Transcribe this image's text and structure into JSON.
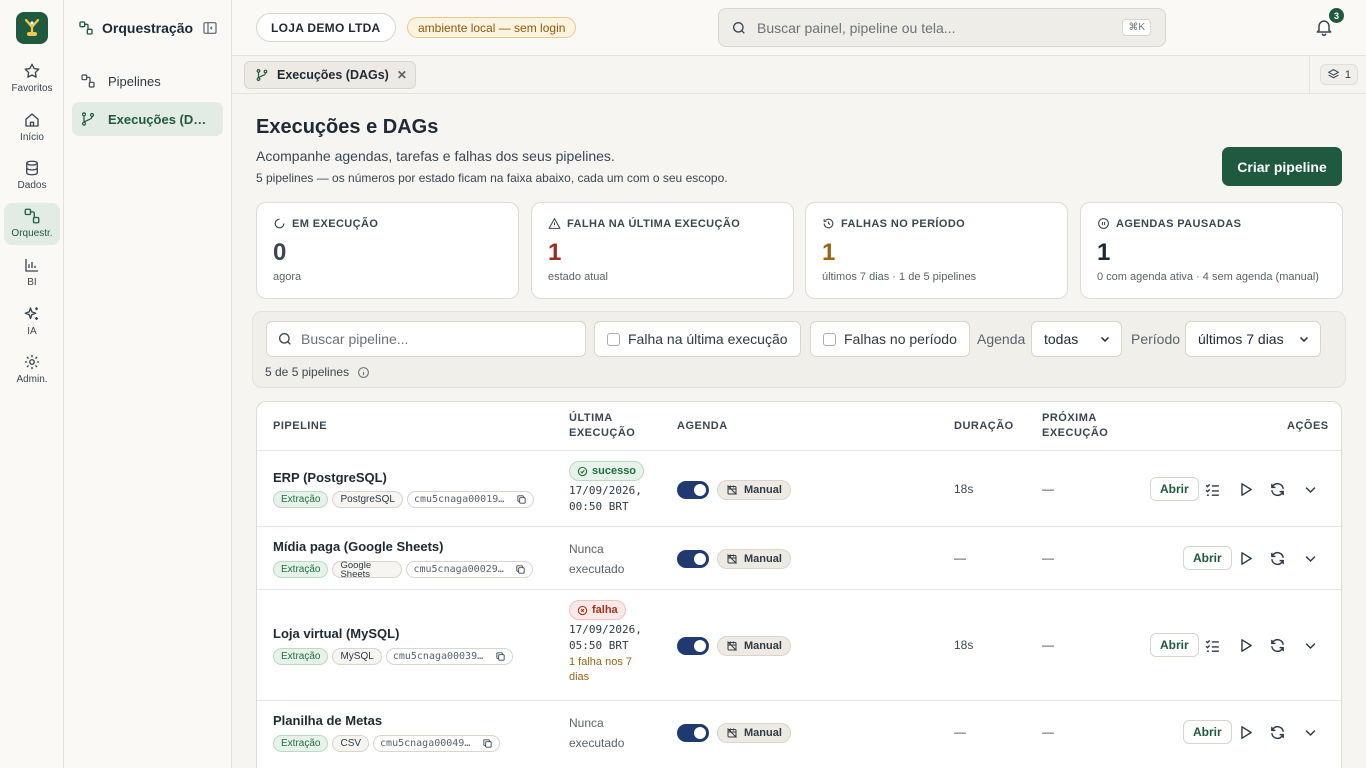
{
  "rail": {
    "items": [
      {
        "label": "Favoritos",
        "icon": "star-icon"
      },
      {
        "label": "Início",
        "icon": "home-icon"
      },
      {
        "label": "Dados",
        "icon": "database-icon"
      },
      {
        "label": "Orquestr.",
        "icon": "workflow-icon"
      },
      {
        "label": "BI",
        "icon": "bar-chart-icon"
      },
      {
        "label": "IA",
        "icon": "sparkles-icon"
      },
      {
        "label": "Admin.",
        "icon": "gear-icon"
      }
    ]
  },
  "sidebar": {
    "title": "Orquestração",
    "items": [
      {
        "label": "Pipelines"
      },
      {
        "label": "Execuções (DAGs)"
      }
    ]
  },
  "topbar": {
    "company": "LOJA DEMO LTDA",
    "env_badge": "ambiente local — sem login",
    "search_placeholder": "Buscar painel, pipeline ou tela...",
    "search_shortcut": "⌘K",
    "notifications": "3"
  },
  "tabs": {
    "active": "Execuções (DAGs)",
    "count": "1"
  },
  "page": {
    "title": "Execuções e DAGs",
    "subtitle": "Acompanhe agendas, tarefas e falhas dos seus pipelines.",
    "note": "5 pipelines — os números por estado ficam na faixa abaixo, cada um com o seu escopo.",
    "create_button": "Criar pipeline"
  },
  "stats": [
    {
      "label": "EM EXECUÇÃO",
      "value": "0",
      "desc": "agora",
      "color": "#3c4650"
    },
    {
      "label": "FALHA NA ÚLTIMA EXECUÇÃO",
      "value": "1",
      "desc": "estado atual",
      "color": "#9b2c1f"
    },
    {
      "label": "FALHAS NO PERÍODO",
      "value": "1",
      "desc": "últimos 7 dias · 1 de 5 pipelines",
      "color": "#9a6512"
    },
    {
      "label": "AGENDAS PAUSADAS",
      "value": "1",
      "desc": "0 com agenda ativa · 4 sem agenda (manual)",
      "color": "#1f2933"
    }
  ],
  "filters": {
    "search_placeholder": "Buscar pipeline...",
    "check_last_fail": "Falha na última execução",
    "check_period_fail": "Falhas no período",
    "agenda_label": "Agenda",
    "agenda_value": "todas",
    "period_label": "Período",
    "period_value": "últimos 7 dias",
    "count": "5 de 5 pipelines"
  },
  "table": {
    "headers": {
      "pipeline": "PIPELINE",
      "last_exec": "ÚLTIMA EXECUÇÃO",
      "agenda": "AGENDA",
      "duration": "DURAÇÃO",
      "next_exec": "PRÓXIMA EXECUÇÃO",
      "actions": "AÇÕES"
    },
    "open_label": "Abrir",
    "manual_label": "Manual",
    "rows": [
      {
        "name": "ERP (PostgreSQL)",
        "tag1": "Extração",
        "tag2": "PostgreSQL",
        "id": "cmu5cnaga00019c...",
        "status": "sucesso",
        "date": "17/09/2026,",
        "time": "00:50 BRT",
        "duration": "18s",
        "next": "—"
      },
      {
        "name": "Mídia paga (Google Sheets)",
        "tag1": "Extração",
        "tag2a": "Google",
        "tag2b": "Sheets",
        "id": "cmu5cnaga00029c...",
        "never1": "Nunca",
        "never2": "executado",
        "duration": "—",
        "next": "—"
      },
      {
        "name": "Loja virtual (MySQL)",
        "tag1": "Extração",
        "tag2": "MySQL",
        "id": "cmu5cnaga00039c...",
        "status": "falha",
        "date": "17/09/2026,",
        "time": "05:50 BRT",
        "failnote1": "1 falha nos 7",
        "failnote2": "dias",
        "duration": "18s",
        "next": "—"
      },
      {
        "name": "Planilha de Metas",
        "tag1": "Extração",
        "tag2": "CSV",
        "id": "cmu5cnaga00049c...",
        "never1": "Nunca",
        "never2": "executado",
        "duration": "—",
        "next": "—"
      }
    ]
  }
}
